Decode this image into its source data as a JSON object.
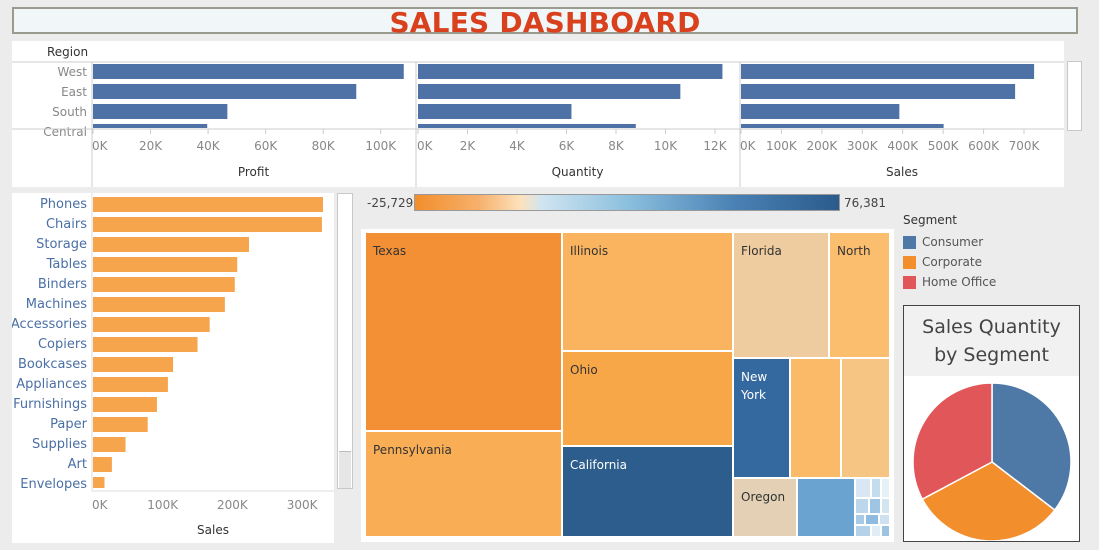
{
  "title": "SALES DASHBOARD",
  "region_chart": {
    "header": "Region",
    "regions": [
      "West",
      "East",
      "South",
      "Central"
    ],
    "panels": [
      {
        "measure": "Profit",
        "values": [
          108000,
          91500,
          46700,
          39700
        ],
        "max": 110000,
        "ticks": [
          "0K",
          "20K",
          "40K",
          "60K",
          "80K",
          "100K"
        ],
        "tick_values": [
          0,
          20000,
          40000,
          60000,
          80000,
          100000
        ]
      },
      {
        "measure": "Quantity",
        "values": [
          12300,
          10600,
          6200,
          8800
        ],
        "max": 12500,
        "ticks": [
          "0K",
          "2K",
          "4K",
          "6K",
          "8K",
          "10K",
          "12K"
        ],
        "tick_values": [
          0,
          2000,
          4000,
          6000,
          8000,
          10000,
          12000
        ]
      },
      {
        "measure": "Sales",
        "values": [
          725000,
          678000,
          391700,
          501200
        ],
        "max": 740000,
        "ticks": [
          "0K",
          "100K",
          "200K",
          "300K",
          "400K",
          "500K",
          "600K",
          "700K"
        ],
        "tick_values": [
          0,
          100000,
          200000,
          300000,
          400000,
          500000,
          600000,
          700000
        ]
      }
    ]
  },
  "chart_data": [
    {
      "type": "bar",
      "orientation": "horizontal",
      "title": "",
      "xlabel": "Sales",
      "ylabel": "",
      "categories": [
        "Phones",
        "Chairs",
        "Storage",
        "Tables",
        "Binders",
        "Machines",
        "Accessories",
        "Copiers",
        "Bookcases",
        "Appliances",
        "Furnishings",
        "Paper",
        "Supplies",
        "Art",
        "Envelopes"
      ],
      "values": [
        330000,
        328500,
        223800,
        206900,
        203400,
        189200,
        167400,
        150000,
        114900,
        107500,
        91700,
        78500,
        46700,
        27100,
        16500
      ],
      "xlim": [
        0,
        340000
      ],
      "xticks": [
        "0K",
        "100K",
        "200K",
        "300K"
      ],
      "color": "#f7a54c"
    },
    {
      "type": "treemap",
      "title": "",
      "color_range": {
        "min_label": "-25,729",
        "max_label": "76,381",
        "min": -25729,
        "max": 76381
      },
      "labels": [
        "Texas",
        "Illinois",
        "Florida",
        "North",
        "Pennsylvania",
        "Ohio",
        "New York",
        "California",
        "Oregon"
      ]
    },
    {
      "type": "pie",
      "title": "Sales Quantity by Segment",
      "legend_title": "Segment",
      "categories": [
        "Consumer",
        "Corporate",
        "Home Office"
      ],
      "values": [
        35.4,
        31.8,
        32.8
      ],
      "colors": [
        "#4e79a7",
        "#f28e2b",
        "#e15759"
      ]
    }
  ]
}
